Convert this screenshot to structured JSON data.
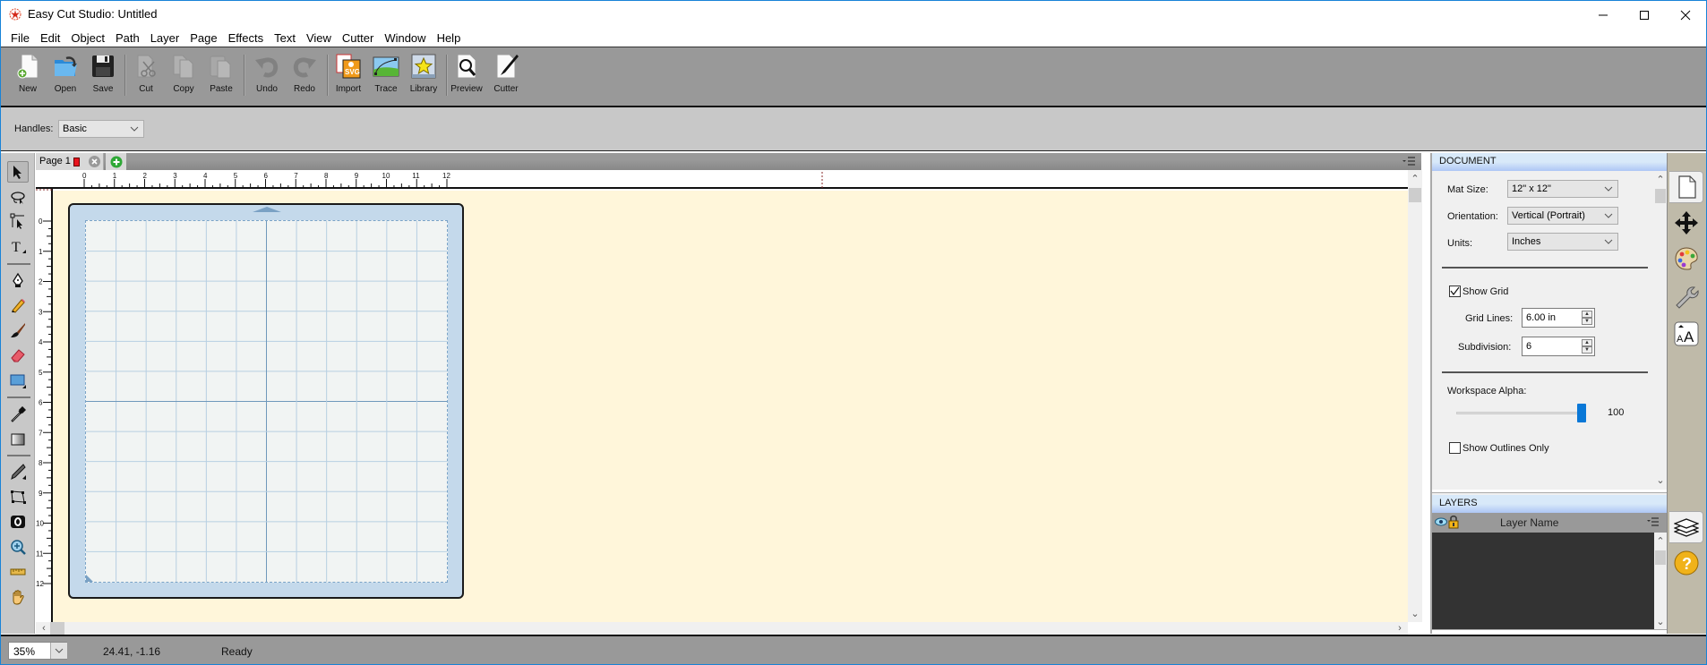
{
  "window": {
    "title": "Easy Cut Studio: Untitled",
    "controls": [
      "minimize",
      "maximize",
      "close"
    ]
  },
  "menubar": {
    "items": [
      "File",
      "Edit",
      "Object",
      "Path",
      "Layer",
      "Page",
      "Effects",
      "Text",
      "View",
      "Cutter",
      "Window",
      "Help"
    ]
  },
  "toolbar": {
    "items": [
      {
        "label": "New",
        "icon": "new-document-icon",
        "enabled": true
      },
      {
        "label": "Open",
        "icon": "open-folder-icon",
        "enabled": true
      },
      {
        "label": "Save",
        "icon": "floppy-disk-icon",
        "enabled": true
      },
      {
        "label": "Cut",
        "icon": "scissors-icon",
        "enabled": false
      },
      {
        "label": "Copy",
        "icon": "copy-icon",
        "enabled": false
      },
      {
        "label": "Paste",
        "icon": "paste-icon",
        "enabled": false
      },
      {
        "label": "Undo",
        "icon": "undo-icon",
        "enabled": false
      },
      {
        "label": "Redo",
        "icon": "redo-icon",
        "enabled": false
      },
      {
        "label": "Import",
        "icon": "import-svg-icon",
        "enabled": true
      },
      {
        "label": "Trace",
        "icon": "trace-icon",
        "enabled": true
      },
      {
        "label": "Library",
        "icon": "library-star-icon",
        "enabled": true
      },
      {
        "label": "Preview",
        "icon": "preview-magnifier-icon",
        "enabled": true
      },
      {
        "label": "Cutter",
        "icon": "cutter-knife-icon",
        "enabled": true
      }
    ]
  },
  "handles": {
    "label": "Handles:",
    "value": "Basic"
  },
  "left_tools": [
    {
      "name": "select-tool",
      "active": true
    },
    {
      "name": "lasso-select-tool",
      "active": false
    },
    {
      "name": "node-select-tool",
      "active": false
    },
    {
      "name": "text-tool",
      "active": false
    },
    {
      "name": "pen-tool",
      "active": false
    },
    {
      "name": "pencil-tool",
      "active": false
    },
    {
      "name": "brush-tool",
      "active": false
    },
    {
      "name": "eraser-tool",
      "active": false
    },
    {
      "name": "rectangle-tool",
      "active": false
    },
    {
      "name": "eyedropper-tool",
      "active": false
    },
    {
      "name": "gradient-tool",
      "active": false
    },
    {
      "name": "knife-tool",
      "active": false
    },
    {
      "name": "distort-tool",
      "active": false
    },
    {
      "name": "contour-tool",
      "active": false
    },
    {
      "name": "zoom-tool",
      "active": false
    },
    {
      "name": "measure-tool",
      "active": false
    },
    {
      "name": "hand-tool",
      "active": false
    }
  ],
  "page_tabs": {
    "tabs": [
      {
        "label": "Page 1",
        "color": "#e8141e"
      }
    ]
  },
  "rulers": {
    "top_ticks": [
      "0",
      "1",
      "2",
      "3",
      "4",
      "5",
      "6",
      "7",
      "8",
      "9",
      "10",
      "11",
      "12"
    ],
    "left_ticks": [
      "0",
      "1",
      "2",
      "3",
      "4",
      "5",
      "6",
      "7",
      "8",
      "9",
      "10",
      "11",
      "12"
    ],
    "units": "inches"
  },
  "mat": {
    "size_in": 12,
    "grid_lines_in": 6,
    "subdivision": 6
  },
  "statusbar": {
    "zoom": "35%",
    "coords": "24.41, -1.16",
    "status": "Ready"
  },
  "document_panel": {
    "header": "DOCUMENT",
    "mat_size": {
      "label": "Mat Size:",
      "value": "12\" x 12\""
    },
    "orientation": {
      "label": "Orientation:",
      "value": "Vertical (Portrait)"
    },
    "units": {
      "label": "Units:",
      "value": "Inches"
    },
    "show_grid": {
      "label": "Show Grid",
      "checked": true
    },
    "grid_lines": {
      "label": "Grid Lines:",
      "value": "6.00 in"
    },
    "subdivision": {
      "label": "Subdivision:",
      "value": "6"
    },
    "workspace_alpha": {
      "label": "Workspace Alpha:",
      "value": 100,
      "display": "100"
    },
    "show_outlines_only": {
      "label": "Show Outlines Only",
      "checked": false
    }
  },
  "layers_panel": {
    "header": "LAYERS",
    "column": "Layer Name",
    "layers": []
  },
  "side_tabs": [
    "document-tab",
    "transform-tab",
    "color-palette-tab",
    "settings-wrench-tab",
    "text-tab",
    "layers-tab",
    "help-tab"
  ],
  "colors": {
    "accent": "#1883d7",
    "canvas_bg": "#fff6da",
    "mat_border": "#c4d9eb",
    "mat_grid": "#f1f4f3",
    "slider_thumb": "#0a78d7"
  }
}
